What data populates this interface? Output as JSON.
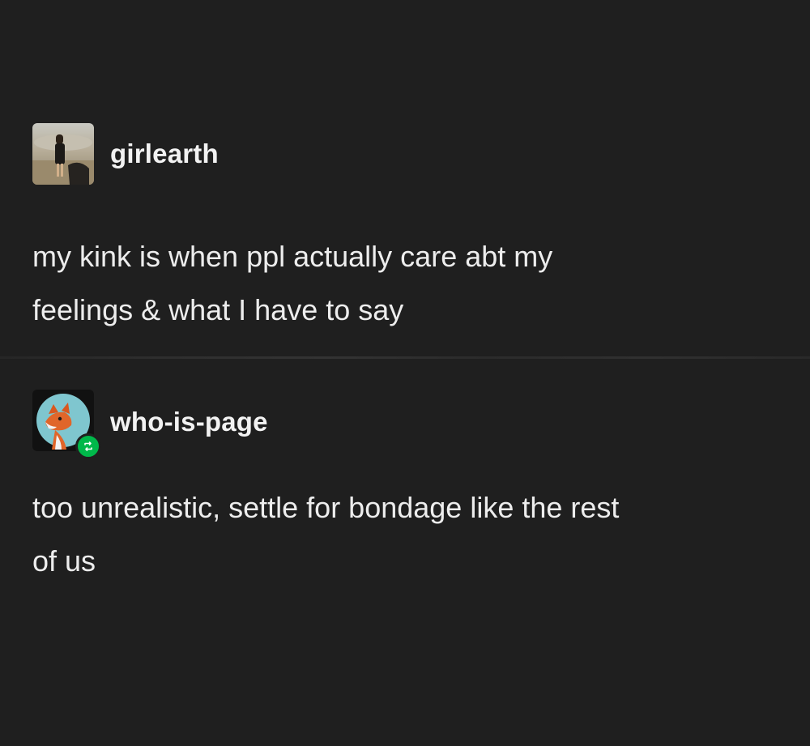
{
  "posts": [
    {
      "username": "girlearth",
      "text_lines": [
        "my kink is when ppl actually care abt my",
        "feelings & what I have to say"
      ]
    },
    {
      "username": "who-is-page",
      "text_lines": [
        "too unrealistic, settle for bondage like the rest",
        "of us"
      ],
      "reblog_badge": "reblog-icon"
    }
  ],
  "colors": {
    "background": "#1f1f1f",
    "text": "#ededed",
    "reblog_badge": "#00b84a"
  }
}
